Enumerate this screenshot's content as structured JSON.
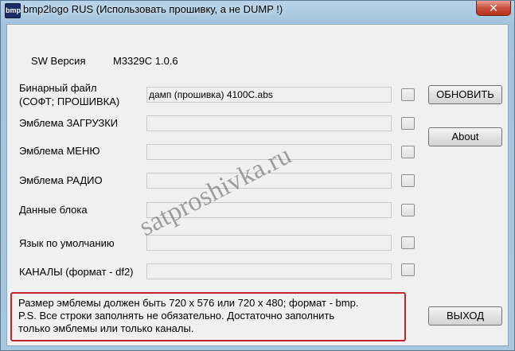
{
  "window": {
    "title": "bmp2logo RUS (Использовать прошивку, а не DUMP !)",
    "app_icon_text": "bmp",
    "close_glyph": "✕"
  },
  "sw": {
    "label": "SW Версия",
    "value": "M3329C 1.0.6"
  },
  "rows": [
    {
      "label": "Бинарный файл",
      "label2": "(СОФТ; ПРОШИВКА)",
      "value": "дамп (прошивка) 4100C.abs"
    },
    {
      "label": "Эмблема  ЗАГРУЗКИ",
      "value": ""
    },
    {
      "label": "Эмблема  МЕНЮ",
      "value": ""
    },
    {
      "label": "Эмблема  РАДИО",
      "value": ""
    },
    {
      "label": "Данные блока",
      "value": ""
    },
    {
      "label": "Язык по умолчанию",
      "value": ""
    },
    {
      "label": "КАНАЛЫ (формат - df2)",
      "value": ""
    }
  ],
  "buttons": {
    "refresh": "ОБНОВИТЬ",
    "about": "About",
    "exit": "ВЫХОД"
  },
  "note": {
    "line1": "Размер эмблемы должен быть 720 х 576 или 720 х 480; формат - bmp.",
    "line2": "P.S.  Все строки заполнять не обязательно. Достаточно заполнить",
    "line3": "только эмблемы или только каналы."
  },
  "watermark": "satproshivka.ru",
  "colors": {
    "note_border": "#c0242e",
    "close_button": "#c9503b"
  }
}
